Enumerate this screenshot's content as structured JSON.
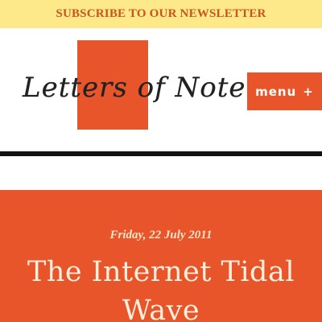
{
  "banner": {
    "text": "SUBSCRIBE TO OUR NEWSLETTER"
  },
  "header": {
    "logo_text": "Letters of Note",
    "menu_label": "menu",
    "menu_symbol": "+"
  },
  "post": {
    "date": "Friday, 22 July 2011",
    "title": "The Internet Tidal Wave"
  },
  "colors": {
    "banner_bg": "#fde98a",
    "banner_text": "#c8541e",
    "accent": "#e8552a",
    "rule": "#111111"
  }
}
